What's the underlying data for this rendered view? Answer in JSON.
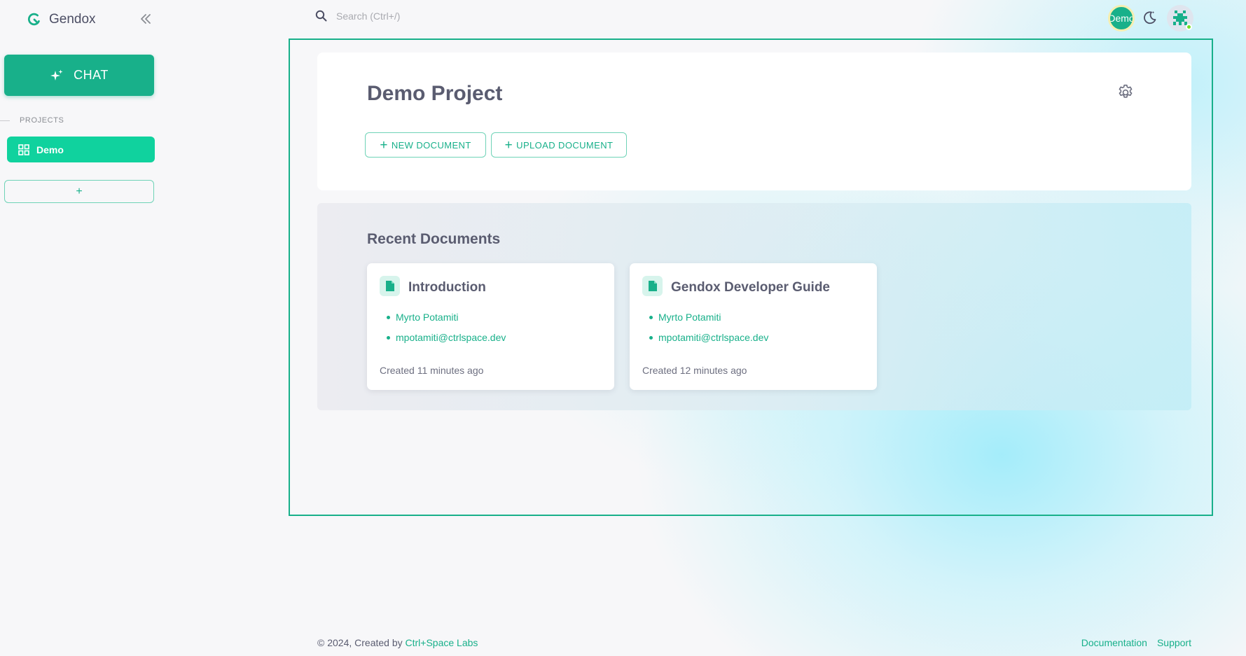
{
  "app": {
    "name": "Gendox"
  },
  "sidebar": {
    "chat_label": "CHAT",
    "section_label": "PROJECTS",
    "projects": [
      {
        "label": "Demo"
      }
    ],
    "add_label": "+"
  },
  "header": {
    "search_placeholder": "Search (Ctrl+/)",
    "org_avatar_label": "Demo"
  },
  "project": {
    "title": "Demo Project",
    "new_document_label": "NEW DOCUMENT",
    "upload_document_label": "UPLOAD DOCUMENT"
  },
  "recent": {
    "title": "Recent Documents",
    "documents": [
      {
        "title": "Introduction",
        "author": "Myrto Potamiti",
        "email": "mpotamiti@ctrlspace.dev",
        "created": "Created 11 minutes ago"
      },
      {
        "title": "Gendox Developer Guide",
        "author": "Myrto Potamiti",
        "email": "mpotamiti@ctrlspace.dev",
        "created": "Created 12 minutes ago"
      }
    ]
  },
  "footer": {
    "copyright": "© 2024, Created by ",
    "company": "Ctrl+Space Labs",
    "links": {
      "documentation": "Documentation",
      "support": "Support"
    }
  },
  "colors": {
    "accent": "#18b08a",
    "accent_light": "#10d29e",
    "text": "#4c4e64"
  },
  "icons": [
    "gendox-logo-icon",
    "chevrons-left-icon",
    "sparkle-icon",
    "grid-icon",
    "search-icon",
    "moon-icon",
    "gear-icon",
    "document-icon"
  ]
}
